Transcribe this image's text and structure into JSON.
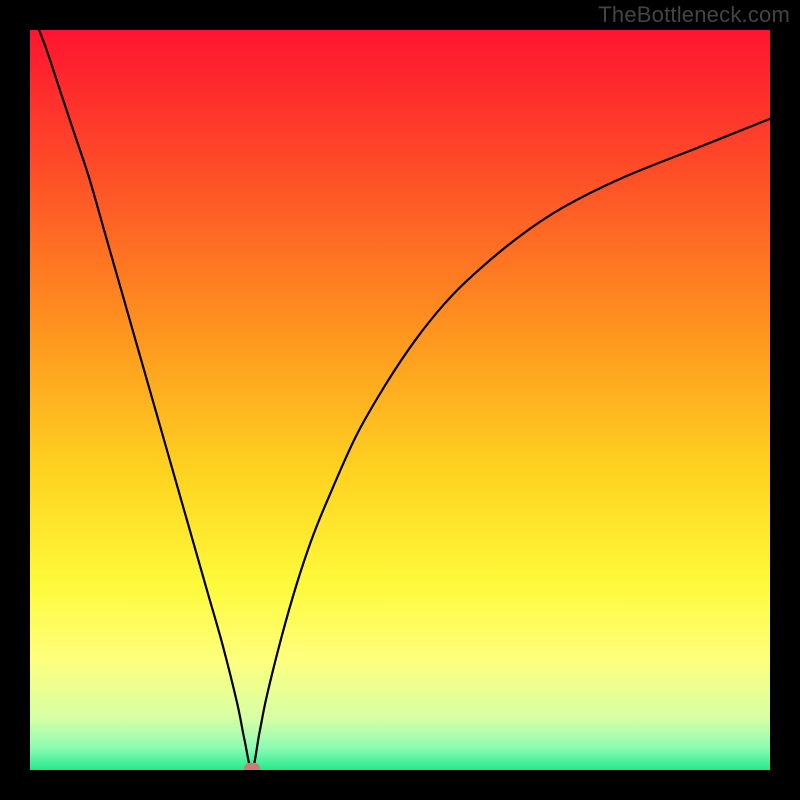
{
  "watermark": "TheBottleneck.com",
  "chart_data": {
    "type": "line",
    "title": "",
    "xlabel": "",
    "ylabel": "",
    "xlim": [
      0,
      100
    ],
    "ylim": [
      0,
      100
    ],
    "minimum_x": 30,
    "series": [
      {
        "name": "curve",
        "x": [
          0,
          2,
          4,
          6,
          8,
          10,
          12,
          14,
          16,
          18,
          20,
          22,
          24,
          26,
          28,
          29,
          30,
          31,
          32,
          34,
          36,
          38,
          40,
          44,
          48,
          52,
          56,
          60,
          66,
          72,
          80,
          90,
          100
        ],
        "y": [
          103,
          98,
          92,
          86,
          80,
          73,
          66,
          59,
          52,
          45,
          38,
          31,
          24,
          17,
          9,
          4,
          0,
          5,
          10,
          18,
          25,
          31,
          36,
          45,
          52,
          58,
          63,
          67,
          72,
          76,
          80,
          84,
          88
        ]
      }
    ],
    "marker": {
      "x": 30,
      "y": 0,
      "color": "#cc7c72"
    },
    "background": {
      "type": "vertical-gradient",
      "stops": [
        {
          "pos": 0.0,
          "color": "#fe1430"
        },
        {
          "pos": 0.2,
          "color": "#fe5027"
        },
        {
          "pos": 0.4,
          "color": "#fe921f"
        },
        {
          "pos": 0.6,
          "color": "#fed420"
        },
        {
          "pos": 0.75,
          "color": "#fefa3b"
        },
        {
          "pos": 0.85,
          "color": "#feff7d"
        },
        {
          "pos": 0.93,
          "color": "#d7ffa5"
        },
        {
          "pos": 0.97,
          "color": "#8cfcb3"
        },
        {
          "pos": 1.0,
          "color": "#25e88d"
        }
      ]
    }
  }
}
